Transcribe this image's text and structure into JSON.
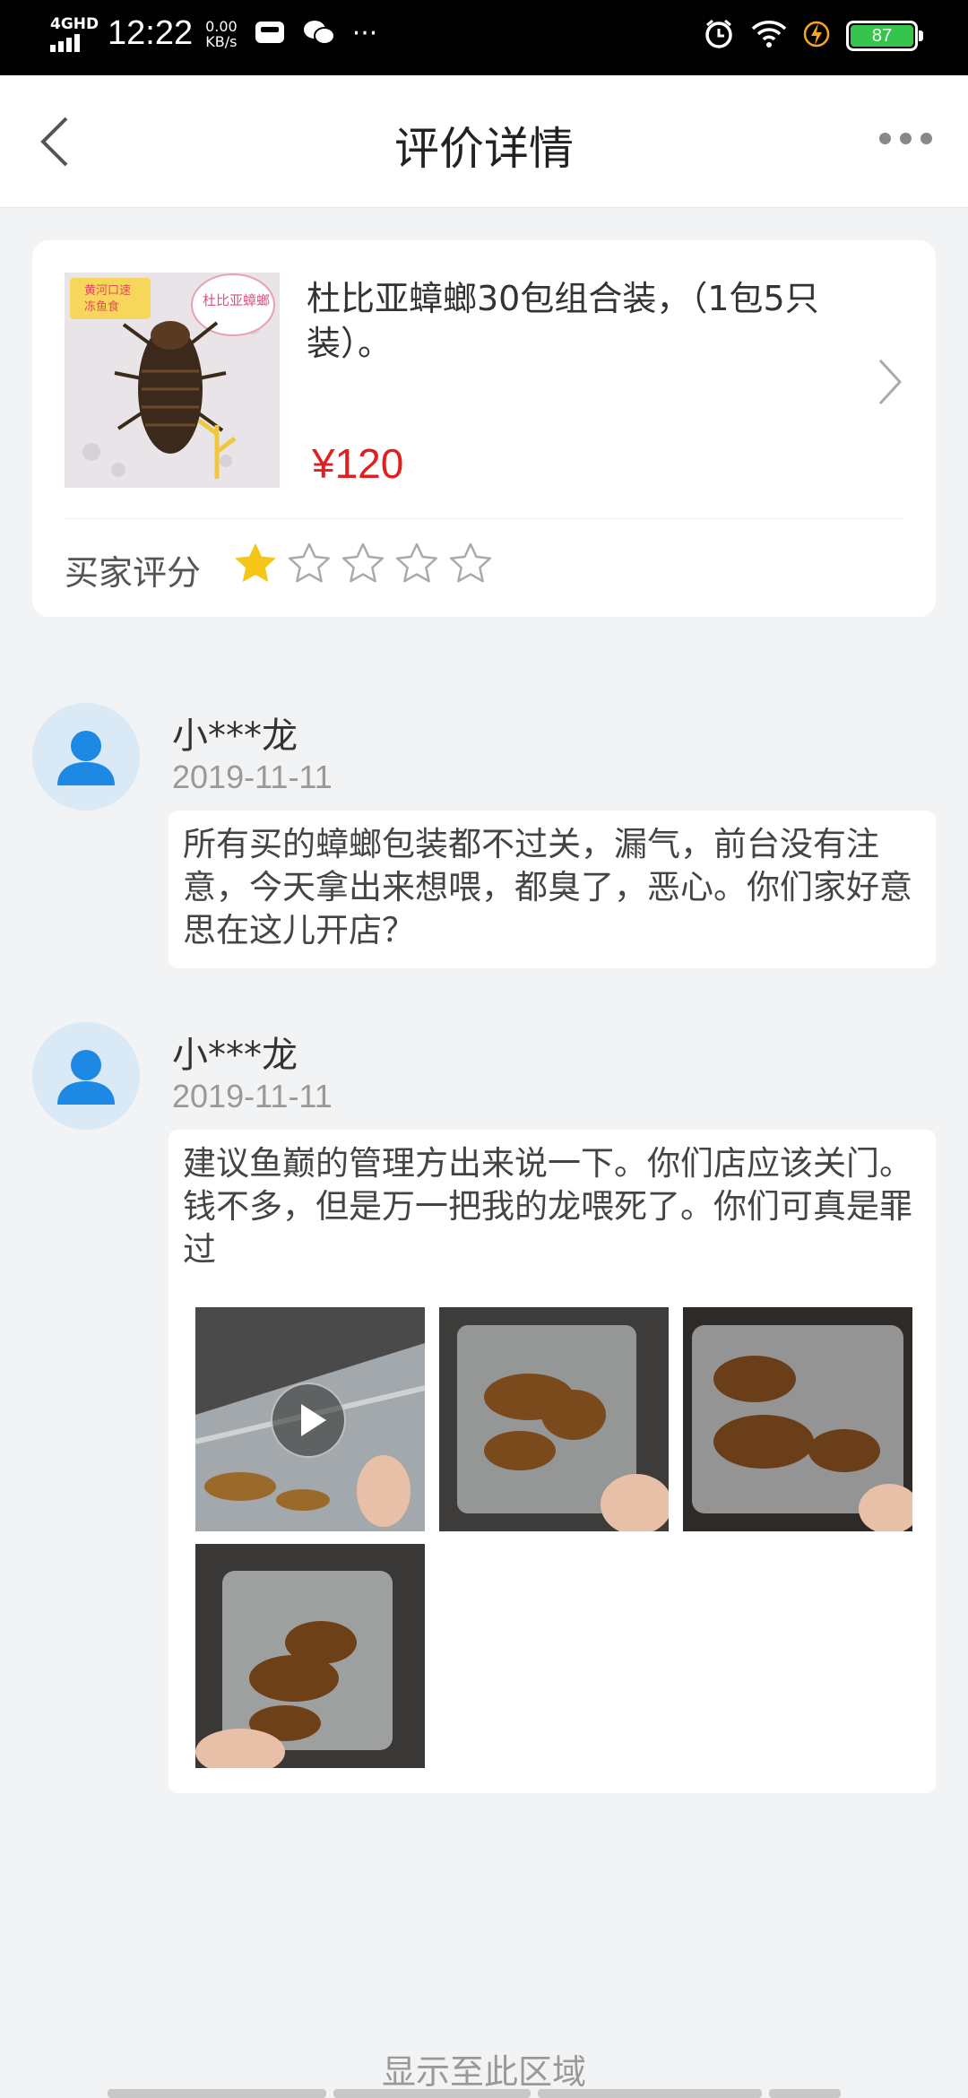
{
  "status_bar": {
    "network": "4GHD",
    "time": "12:22",
    "speed_value": "0.00",
    "speed_unit": "KB/s",
    "more": "···",
    "battery": "87"
  },
  "header": {
    "title": "评价详情"
  },
  "product": {
    "name": "杜比亚蟑螂30包组合装，（1包5只装）。",
    "price": "¥120",
    "image_tag_top": "黄河口速",
    "image_tag_bottom": "冻鱼食",
    "image_bubble": "杜比亚蟑螂"
  },
  "rating": {
    "label": "买家评分",
    "value": 1,
    "max": 5,
    "star_color": "#f5c518"
  },
  "reviews": [
    {
      "user": "小***龙",
      "date": "2019-11-11",
      "text": "所有买的蟑螂包装都不过关，漏气，前台没有注意，今天拿出来想喂，都臭了，恶心。你们家好意思在这儿开店？"
    },
    {
      "user": "小***龙",
      "date": "2019-11-11",
      "text": "建议鱼巅的管理方出来说一下。你们店应该关门。钱不多，但是万一把我的龙喂死了。你们可真是罪过",
      "media": [
        {
          "type": "video",
          "icon": "play-icon"
        },
        {
          "type": "image"
        },
        {
          "type": "image"
        },
        {
          "type": "image"
        }
      ]
    }
  ],
  "footer": {
    "note": "显示至此区域"
  }
}
